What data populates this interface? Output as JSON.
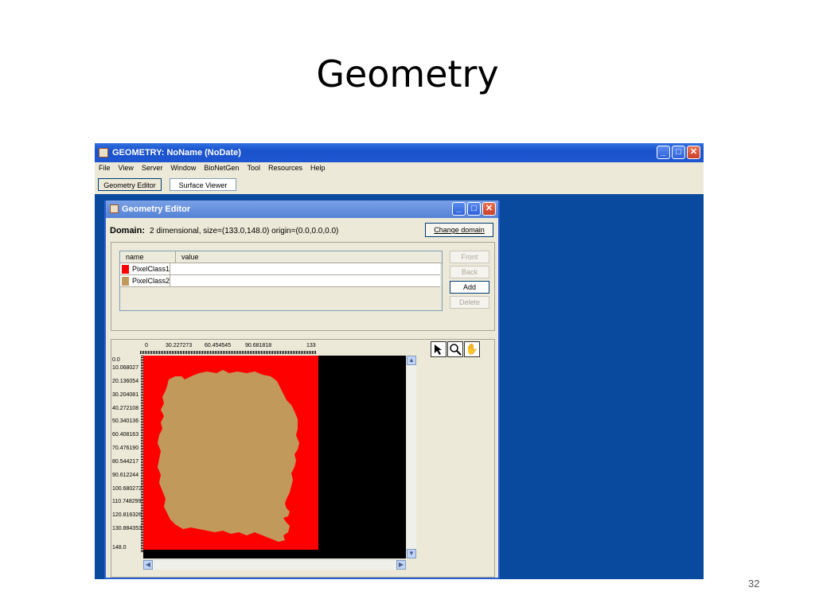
{
  "slide": {
    "title": "Geometry",
    "page_number": "32"
  },
  "app": {
    "title": "GEOMETRY: NoName (NoDate)",
    "menu": [
      "File",
      "View",
      "Server",
      "Window",
      "BioNetGen",
      "Tool",
      "Resources",
      "Help"
    ],
    "tabs": [
      "Geometry Editor",
      "Surface Viewer"
    ],
    "active_tab": "Geometry Editor"
  },
  "editor": {
    "title": "Geometry Editor",
    "domain_label": "Domain:",
    "domain_text": "2 dimensional,  size=(133.0,148.0)  origin=(0.0,0.0,0.0)",
    "change_domain": "Change domain",
    "table": {
      "columns": [
        "name",
        "value"
      ],
      "rows": [
        {
          "name": "PixelClass1",
          "value": "",
          "color": "#ff0000"
        },
        {
          "name": "PixelClass2",
          "value": "",
          "color": "#c19a5b"
        }
      ]
    },
    "buttons": {
      "front": "Front",
      "back": "Back",
      "add": "Add",
      "delete": "Delete"
    },
    "x_ticks": [
      "0",
      "30.227273",
      "60.454545",
      "90.681818",
      "133"
    ],
    "y_ticks": [
      "0.0",
      "10.068027",
      "20.136054",
      "30.204081",
      "40.272108",
      "50.340136",
      "60.408163",
      "70.476190",
      "80.544217",
      "90.612244",
      "100.680272",
      "110.748299",
      "120.816326",
      "130.884353",
      "148.0"
    ],
    "colors": {
      "background_region": "#ff0000",
      "shape_region": "#c19a5b",
      "outside": "#000000"
    }
  }
}
